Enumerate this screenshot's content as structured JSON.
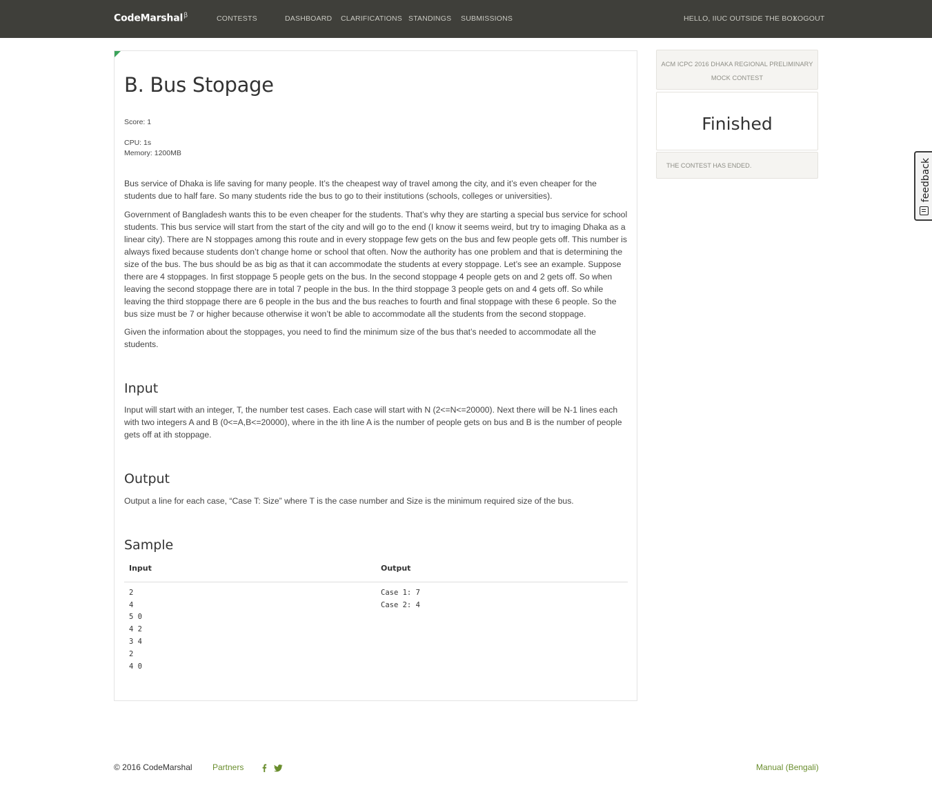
{
  "navbar": {
    "brand": "CodeMarshal",
    "brand_sup": "β",
    "links": [
      "CONTESTS",
      "DASHBOARD",
      "CLARIFICATIONS",
      "STANDINGS",
      "SUBMISSIONS"
    ],
    "greeting": "HELLO, IIUC OUTSIDE THE BOX",
    "logout": "LOGOUT"
  },
  "problem": {
    "title": "B. Bus Stopage",
    "score": "Score: 1",
    "cpu": "CPU: 1s",
    "memory": "Memory: 1200MB",
    "statement": [
      "Bus service of Dhaka is life saving for many people. It’s the cheapest way of travel among the city, and it’s even cheaper for the students due to half fare. So many students ride the bus to go to their institutions (schools, colleges or universities).",
      "Government of Bangladesh wants this to be even cheaper for the students. That’s why they are starting a special bus service for school students. This bus service will start from the start of the city and will go to the end (I know it seems weird, but try to imaging Dhaka as a linear city). There are N stoppages among this route and in every stoppage few gets on the bus and few people gets off. This number is always fixed because students don’t change home or school that often. Now the authority has one problem and that is determining the size of the bus. The bus should be as big as that it can accommodate the students at every stoppage. Let’s see an example. Suppose there are 4 stoppages. In first stoppage 5 people gets on the bus. In the second stoppage 4 people gets on and 2 gets off. So when leaving the second stoppage there are in total 7 people in the bus. In the third stoppage 3 people gets on and 4 gets off. So while leaving the third stoppage there are 6 people in the bus and the bus reaches to fourth and final stoppage with these 6 people. So the bus size must be 7 or higher because otherwise it won’t be able to accommodate all the students from the second stoppage.",
      "Given the information about the stoppages, you need to find the minimum size of the bus that’s needed to accommodate all the students."
    ],
    "input_heading": "Input",
    "input_text": "Input will start with an integer, T, the number test cases. Each case will start with N (2<=N<=20000). Next there will be N-1 lines each with two integers A and B (0<=A,B<=20000), where in the ith line A is the number of people gets on bus and B is the number of people gets off at ith stoppage.",
    "output_heading": "Output",
    "output_text": "Output a line for each case, “Case T: Size” where T is the case number and Size is the minimum required size of the bus.",
    "sample_heading": "Sample",
    "sample": {
      "input_label": "Input",
      "output_label": "Output",
      "input_lines": [
        "2",
        "4",
        "5 0",
        "4 2",
        "3 4",
        "2",
        "4 0"
      ],
      "output_lines": [
        "Case 1: 7",
        "Case 2: 4"
      ]
    }
  },
  "sidebar": {
    "contest_name": "ACM ICPC 2016 DHAKA REGIONAL PRELIMINARY MOCK CONTEST",
    "status": "Finished",
    "status_note": "THE CONTEST HAS ENDED."
  },
  "feedback": {
    "label": "feedback",
    "icon": "feedback-icon"
  },
  "footer": {
    "copyright": "© 2016 CodeMarshal",
    "partners": "Partners",
    "social_icons": [
      "facebook-icon",
      "twitter-icon"
    ],
    "manual": "Manual (Bengali)"
  },
  "colors": {
    "navbar_bg": "#3f3f3a",
    "accent_green": "#3aa35a",
    "link_green": "#6a8e2e",
    "panel_bg": "#f5f4f1"
  }
}
